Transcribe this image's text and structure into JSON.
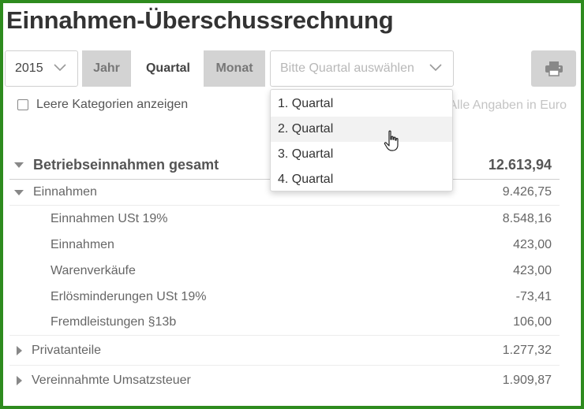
{
  "title": "Einnahmen-Überschussrechnung",
  "filters": {
    "year": "2015",
    "periods": [
      "Jahr",
      "Quartal",
      "Monat"
    ],
    "active_period": "Quartal",
    "quarter_placeholder": "Bitte Quartal auswählen",
    "quarter_options": [
      "1. Quartal",
      "2. Quartal",
      "3. Quartal",
      "4. Quartal"
    ],
    "hovered_option": "2. Quartal"
  },
  "options": {
    "empty_categories_label": "Leere Kategorien anzeigen",
    "currency_note": "Alle Angaben in Euro"
  },
  "table": {
    "total": {
      "label": "Betriebseinnahmen gesamt",
      "value": "12.613,94"
    },
    "rows": [
      {
        "label": "Einnahmen",
        "value": "9.426,75"
      },
      {
        "label": "Einnahmen USt 19%",
        "value": "8.548,16"
      },
      {
        "label": "Einnahmen",
        "value": "423,00"
      },
      {
        "label": "Warenverkäufe",
        "value": "423,00"
      },
      {
        "label": "Erlösminderungen USt 19%",
        "value": "-73,41"
      },
      {
        "label": "Fremdleistungen §13b",
        "value": "106,00"
      },
      {
        "label": "Privatanteile",
        "value": "1.277,32"
      },
      {
        "label": "Vereinnahmte Umsatzsteuer",
        "value": "1.909,87"
      }
    ]
  },
  "icons": [
    "chevron-down-icon",
    "printer-icon",
    "caret-down-icon",
    "caret-right-icon",
    "hand-cursor-icon"
  ],
  "colors": {
    "frame": "#2e8b1e",
    "segment_inactive": "#d3d3d3",
    "placeholder": "#b8b8b8"
  }
}
